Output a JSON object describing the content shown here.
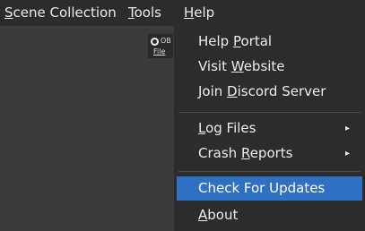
{
  "menubar": {
    "scene_collection": {
      "u": "S",
      "rest": "cene Collection"
    },
    "tools": {
      "u": "T",
      "rest": "ools"
    },
    "help": {
      "u": "H",
      "rest": "elp"
    }
  },
  "mini_window": {
    "title": "OB",
    "file_menu": "File"
  },
  "help_menu": {
    "help_portal": {
      "pre": "Help ",
      "u": "P",
      "post": "ortal"
    },
    "visit_website": {
      "pre": "Visit ",
      "u": "W",
      "post": "ebsite"
    },
    "join_discord": {
      "pre": "Join ",
      "u": "D",
      "post": "iscord Server"
    },
    "log_files": {
      "pre": "",
      "u": "L",
      "post": "og Files"
    },
    "crash_reports": {
      "pre": "Crash ",
      "u": "R",
      "post": "eports"
    },
    "check_updates": "Check For Updates",
    "about": {
      "pre": "",
      "u": "A",
      "post": "bout"
    },
    "submenu_arrow": "▸",
    "highlight_color": "#2f6fc4"
  }
}
